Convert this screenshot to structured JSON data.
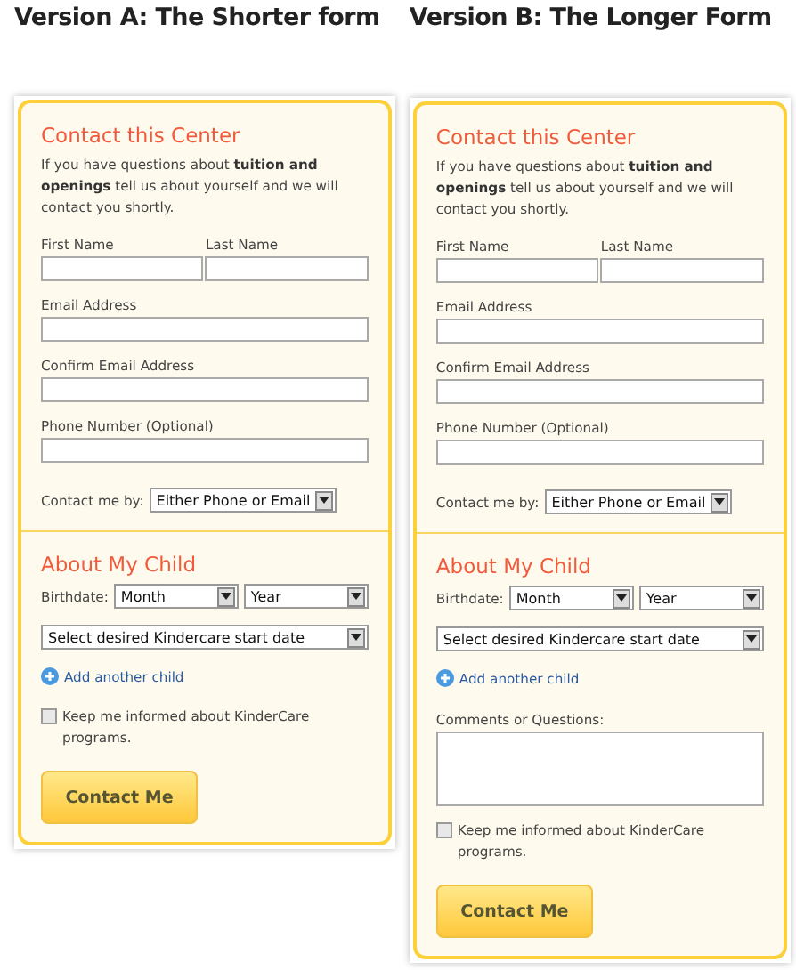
{
  "versions": [
    {
      "heading": "Version A: The Shorter form",
      "form": {
        "title": "Contact this Center",
        "intro": "If you have questions about **tuition and openings** tell us about yourself and we will contact you shortly.",
        "first_name": "First Name",
        "last_name": "Last Name",
        "fields": [
          {
            "label": "Email Address"
          },
          {
            "label": "Confirm Email Address"
          },
          {
            "label": "Phone Number (Optional)"
          }
        ],
        "contact": {
          "label": "Contact me by:",
          "value": "Either Phone or Email"
        },
        "child_title": "About My Child",
        "birthdate": {
          "label": "Birthdate:",
          "month": "Month",
          "year": "Year"
        },
        "start_date": "Select desired Kindercare start date",
        "add_child": "Add another child",
        "checkbox": {
          "label": "Keep me informed about KinderCare programs.",
          "checked": false
        },
        "button": "Contact Me"
      }
    },
    {
      "heading": "Version B: The Longer Form",
      "form": {
        "title": "Contact this Center",
        "intro": "If you have questions about **tuition and openings** tell us about yourself and we will contact you shortly.",
        "first_name": "First Name",
        "last_name": "Last Name",
        "fields": [
          {
            "label": "Email Address"
          },
          {
            "label": "Confirm Email Address"
          },
          {
            "label": "Phone Number (Optional)"
          }
        ],
        "contact": {
          "label": "Contact me by:",
          "value": "Either Phone or Email"
        },
        "child_title": "About My Child",
        "birthdate": {
          "label": "Birthdate:",
          "month": "Month",
          "year": "Year"
        },
        "start_date": "Select desired Kindercare start date",
        "add_child": "Add another child",
        "comments": {
          "label": "Comments or Questions:"
        },
        "checkbox": {
          "label": "Keep me informed about KinderCare programs.",
          "checked": false
        },
        "button": "Contact Me"
      }
    }
  ]
}
